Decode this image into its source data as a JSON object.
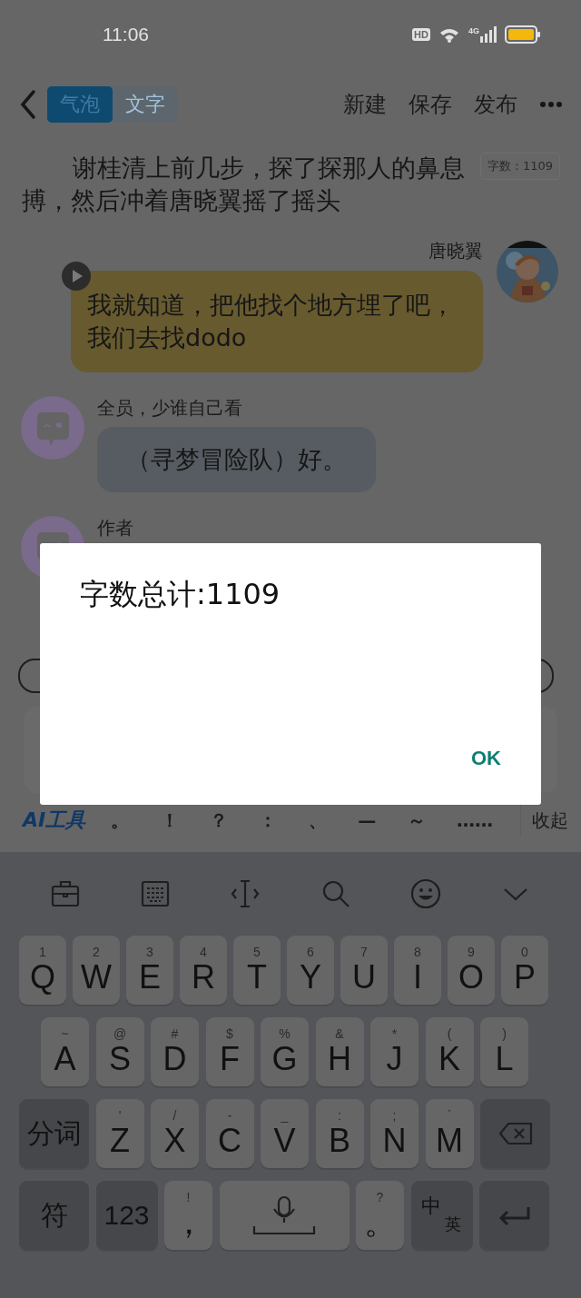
{
  "status_bar": {
    "time": "11:06",
    "hd": "HD",
    "network": "4G"
  },
  "header": {
    "tabs": [
      {
        "label": "气泡",
        "selected": true
      },
      {
        "label": "文字",
        "selected": false
      }
    ],
    "actions": [
      "新建",
      "保存",
      "发布"
    ]
  },
  "word_count": "字数：1109",
  "narration": [
    "谢桂清上前几步，探了探那人的鼻息",
    "搏，然后冲着唐晓翼摇了摇头"
  ],
  "messages": [
    {
      "kind": "right",
      "name": "唐晓翼",
      "text": "我就知道，把他找个地方埋了吧，我们去找dodo",
      "color": "#675a2f"
    },
    {
      "kind": "left",
      "name": "全员，少谁自己看",
      "text": "（寻梦冒险队）好。",
      "color": "#575c62"
    },
    {
      "kind": "left",
      "name": "作者"
    }
  ],
  "input_toolbar": {
    "ai_tools": "AI工具",
    "punctuation": [
      "。",
      "！",
      "？",
      "：",
      "、",
      "—",
      "～",
      "……"
    ],
    "collapse": "收起"
  },
  "keyboard": {
    "key_lines": [
      [
        {
          "kind": "letter",
          "main": "Q",
          "sub": "1"
        },
        {
          "kind": "letter",
          "main": "W",
          "sub": "2"
        },
        {
          "kind": "letter",
          "main": "E",
          "sub": "3"
        },
        {
          "kind": "letter",
          "main": "R",
          "sub": "4"
        },
        {
          "kind": "letter",
          "main": "T",
          "sub": "5"
        },
        {
          "kind": "letter",
          "main": "Y",
          "sub": "6"
        },
        {
          "kind": "letter",
          "main": "U",
          "sub": "7"
        },
        {
          "kind": "letter",
          "main": "I",
          "sub": "8"
        },
        {
          "kind": "letter",
          "main": "O",
          "sub": "9"
        },
        {
          "kind": "letter",
          "main": "P",
          "sub": "0"
        }
      ],
      [
        {
          "kind": "letter",
          "main": "A",
          "sub": "~"
        },
        {
          "kind": "letter",
          "main": "S",
          "sub": "@"
        },
        {
          "kind": "letter",
          "main": "D",
          "sub": "#"
        },
        {
          "kind": "letter",
          "main": "F",
          "sub": "$"
        },
        {
          "kind": "letter",
          "main": "G",
          "sub": "%"
        },
        {
          "kind": "letter",
          "main": "H",
          "sub": "&"
        },
        {
          "kind": "letter",
          "main": "J",
          "sub": "*"
        },
        {
          "kind": "letter",
          "main": "K",
          "sub": "("
        },
        {
          "kind": "letter",
          "main": "L",
          "sub": ")"
        }
      ],
      [
        {
          "kind": "function",
          "main": "分词"
        },
        {
          "kind": "letter",
          "main": "Z",
          "sub": "'"
        },
        {
          "kind": "letter",
          "main": "X",
          "sub": "/"
        },
        {
          "kind": "letter",
          "main": "C",
          "sub": "-"
        },
        {
          "kind": "letter",
          "main": "V",
          "sub": "_"
        },
        {
          "kind": "letter",
          "main": "B",
          "sub": ":"
        },
        {
          "kind": "letter",
          "main": "N",
          "sub": ";"
        },
        {
          "kind": "letter",
          "main": "M",
          "sub": "`"
        },
        {
          "kind": "backspace"
        }
      ],
      [
        {
          "kind": "function",
          "main": "符"
        },
        {
          "kind": "function",
          "main": "123"
        },
        {
          "kind": "letter",
          "main": "，",
          "sub": "!"
        },
        {
          "kind": "space"
        },
        {
          "kind": "letter",
          "main": "。",
          "sub": "?"
        },
        {
          "kind": "lang",
          "main": "中",
          "sub": "英"
        },
        {
          "kind": "enter"
        }
      ]
    ]
  },
  "dialog": {
    "title": "字数总计:1109",
    "button": "OK"
  }
}
